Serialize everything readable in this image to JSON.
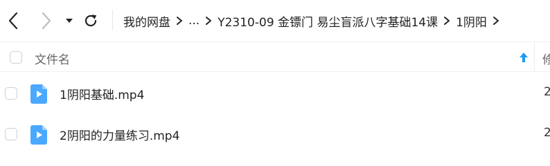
{
  "navigation": {
    "breadcrumb": [
      "我的网盘",
      "...",
      "Y2310-09 金镖门 易尘盲派八字基础14课",
      "1阴阳"
    ]
  },
  "list_header": {
    "name_column": "文件名",
    "modified_column": "修",
    "sort_direction": "ascending"
  },
  "files": [
    {
      "name": "1阴阳基础.mp4",
      "type": "video",
      "modified": "2"
    },
    {
      "name": "2阴阳的力量练习.mp4",
      "type": "video",
      "modified": "2"
    }
  ],
  "colors": {
    "accent": "#1e9bf0",
    "video_icon": "#4aa8ff",
    "text": "#222222",
    "muted_text": "#666666",
    "divider": "#f0f0f0"
  },
  "icons": {
    "back": "chevron-left-icon",
    "forward": "chevron-right-icon",
    "dropdown": "caret-down-icon",
    "refresh": "refresh-icon",
    "breadcrumb_separator": "chevron-right-icon",
    "sort": "arrow-up-icon",
    "file": "video-file-icon"
  }
}
